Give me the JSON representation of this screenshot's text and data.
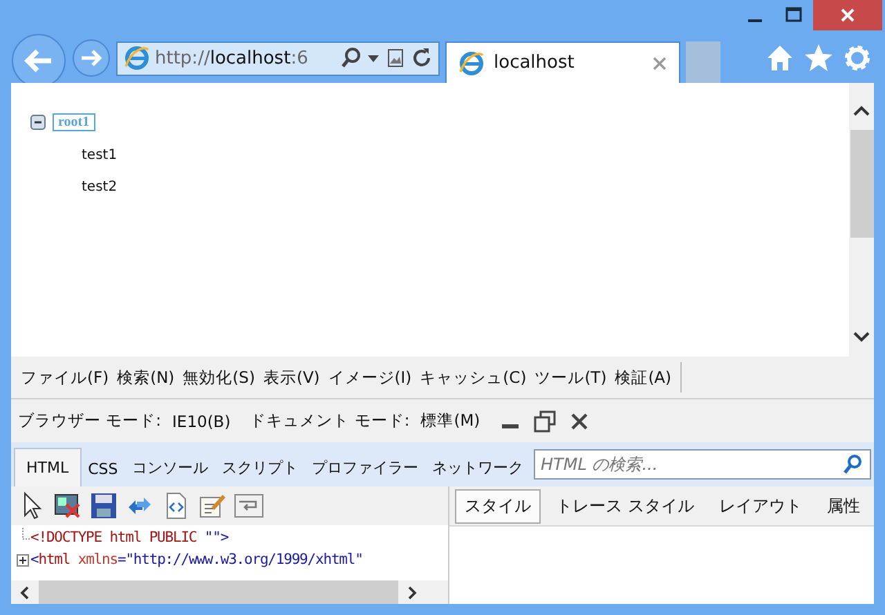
{
  "address_bar": {
    "url_prefix": "http://",
    "url_host": "localhost",
    "url_rest": ":6"
  },
  "tabs": [
    {
      "title": "localhost",
      "selected": true
    }
  ],
  "tree": [
    {
      "label": "root1",
      "expanded": true,
      "selected": true,
      "children": [
        {
          "label": "test1"
        },
        {
          "label": "test2"
        }
      ]
    }
  ],
  "devtools": {
    "menu": [
      "ファイル(F)",
      "検索(N)",
      "無効化(S)",
      "表示(V)",
      "イメージ(I)",
      "キャッシュ(C)",
      "ツール(T)",
      "検証(A)"
    ],
    "modes": [
      {
        "label": "ブラウザー モード:",
        "value": "IE10(B)"
      },
      {
        "label": "ドキュメント モード:",
        "value": "標準(M)"
      }
    ],
    "tabs": [
      {
        "label": "HTML",
        "selected": true
      },
      {
        "label": "CSS",
        "selected": false
      },
      {
        "label": "コンソール",
        "selected": false
      },
      {
        "label": "スクリプト",
        "selected": false
      },
      {
        "label": "プロファイラー",
        "selected": false
      },
      {
        "label": "ネットワーク",
        "selected": false
      }
    ],
    "search": {
      "placeholder": "HTML の検索..."
    },
    "pane_tabs": [
      {
        "label": "スタイル",
        "selected": true
      },
      {
        "label": "トレース スタイル",
        "selected": false
      },
      {
        "label": "レイアウト",
        "selected": false
      },
      {
        "label": "属性",
        "selected": false
      }
    ],
    "code_lines": [
      {
        "expandable": false,
        "tokens": [
          {
            "kind": "tag",
            "text": "<!DOCTYPE html PUBLIC "
          },
          {
            "kind": "value",
            "text": "\"\">"
          }
        ]
      },
      {
        "expandable": true,
        "tokens": [
          {
            "kind": "punct",
            "text": "<"
          },
          {
            "kind": "tag",
            "text": "html "
          },
          {
            "kind": "attr",
            "text": "xmlns"
          },
          {
            "kind": "punct",
            "text": "="
          },
          {
            "kind": "value",
            "text": "\"http://www.w3.org/1999/xhtml\""
          }
        ]
      }
    ]
  }
}
